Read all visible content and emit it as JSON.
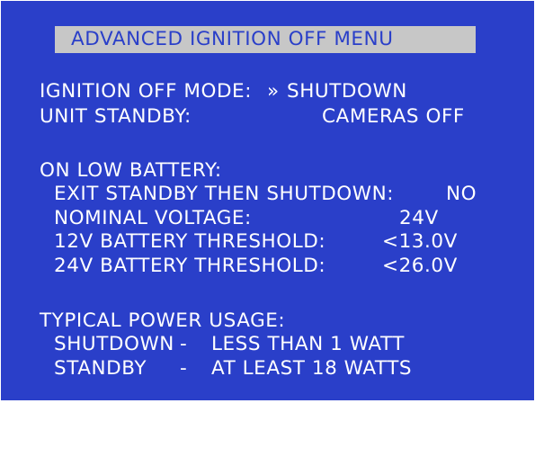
{
  "menu": {
    "title": "ADVANCED IGNITION OFF MENU",
    "ignition_off_mode": {
      "label": "IGNITION OFF MODE:",
      "cursor": "»",
      "value": "SHUTDOWN"
    },
    "unit_standby": {
      "label": "UNIT STANDBY:",
      "value": "CAMERAS OFF"
    },
    "low_battery": {
      "heading": "ON LOW BATTERY:",
      "exit_standby": {
        "label": "EXIT STANDBY THEN SHUTDOWN:",
        "value": "NO"
      },
      "nominal_voltage": {
        "label": "NOMINAL VOLTAGE:",
        "value": "24V"
      },
      "threshold_12v": {
        "label": "12V BATTERY THRESHOLD:",
        "value": "<13.0V"
      },
      "threshold_24v": {
        "label": "24V BATTERY THRESHOLD:",
        "value": "<26.0V"
      }
    },
    "power_usage": {
      "heading": "TYPICAL POWER USAGE:",
      "shutdown": {
        "label": "SHUTDOWN",
        "sep": "-",
        "value": "LESS THAN 1 WATT"
      },
      "standby": {
        "label": "STANDBY",
        "sep": "-",
        "value": "AT LEAST 18 WATTS"
      }
    }
  },
  "colors": {
    "screen_background": "#2a3fc9",
    "text": "#ffffff",
    "title_background": "#c7c7c7",
    "title_text": "#2a3fc9"
  }
}
